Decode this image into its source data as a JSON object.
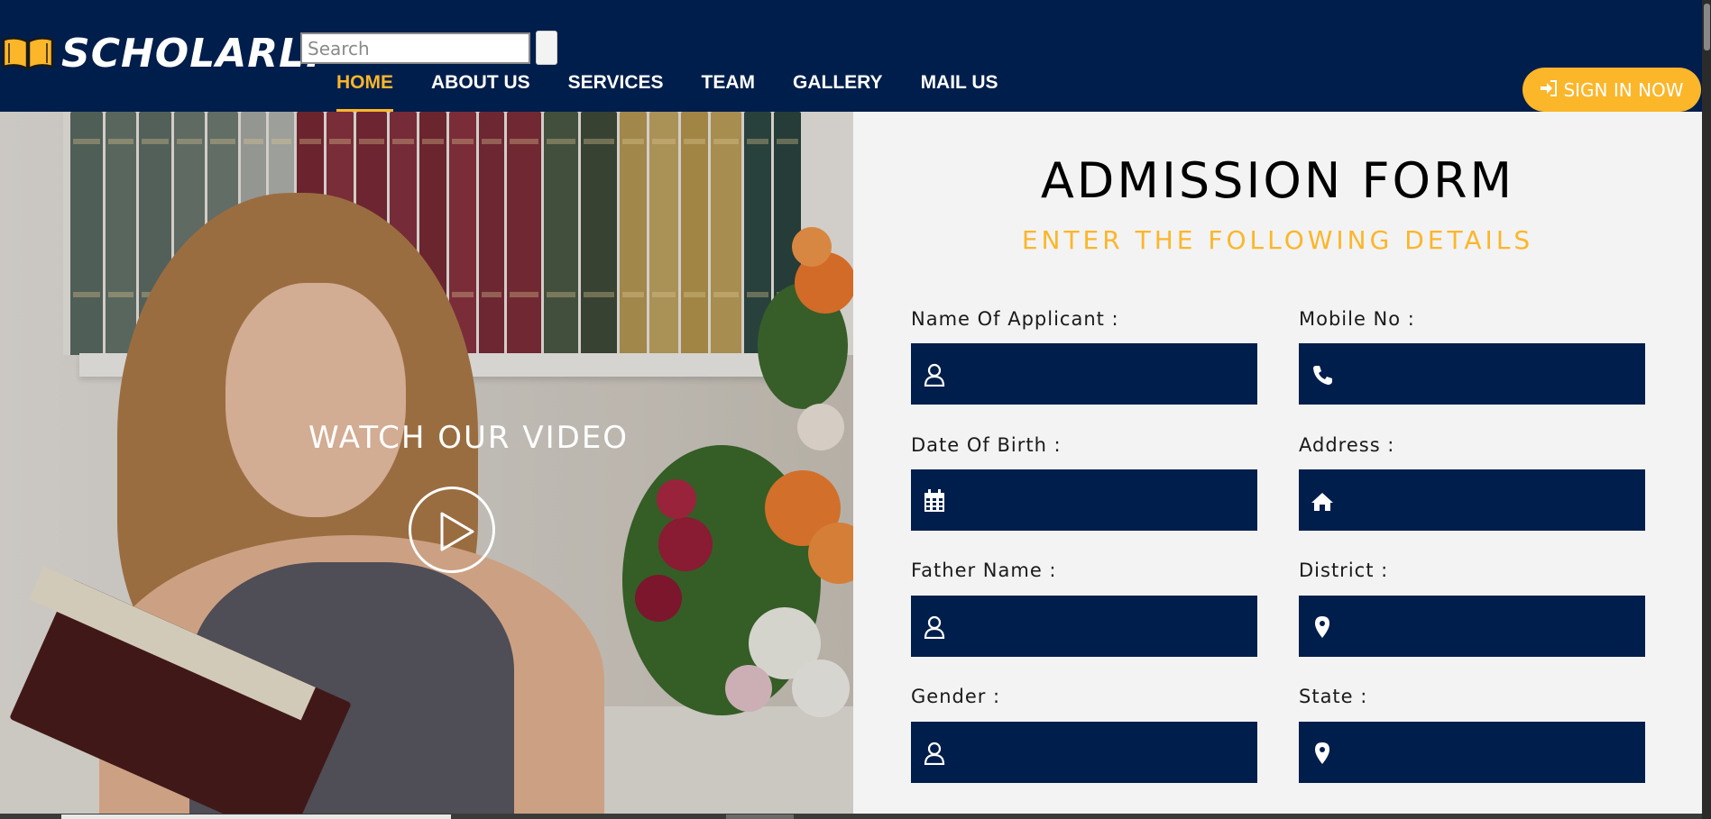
{
  "brand": {
    "name": "SCHOLARLY",
    "logo_icon": "open-book-icon"
  },
  "search": {
    "placeholder": "Search",
    "value": ""
  },
  "nav": {
    "items": [
      {
        "label": "HOME",
        "active": true
      },
      {
        "label": "ABOUT US",
        "active": false
      },
      {
        "label": "SERVICES",
        "active": false
      },
      {
        "label": "TEAM",
        "active": false
      },
      {
        "label": "GALLERY",
        "active": false
      },
      {
        "label": "MAIL US",
        "active": false
      }
    ]
  },
  "signin": {
    "label": "SIGN IN NOW",
    "icon": "sign-in-icon"
  },
  "hero": {
    "video_title": "WATCH OUR VIDEO",
    "play_icon": "play-icon"
  },
  "form": {
    "title": "ADMISSION FORM",
    "subtitle": "ENTER THE FOLLOWING DETAILS",
    "fields": [
      {
        "label": "Name Of Applicant :",
        "icon": "user-icon",
        "value": ""
      },
      {
        "label": "Mobile No :",
        "icon": "phone-icon",
        "value": ""
      },
      {
        "label": "Date Of Birth :",
        "icon": "calendar-icon",
        "value": ""
      },
      {
        "label": "Address :",
        "icon": "home-icon",
        "value": ""
      },
      {
        "label": "Father Name :",
        "icon": "user-icon",
        "value": ""
      },
      {
        "label": "District :",
        "icon": "map-marker-icon",
        "value": ""
      },
      {
        "label": "Gender :",
        "icon": "user-icon",
        "value": ""
      },
      {
        "label": "State :",
        "icon": "map-marker-icon",
        "value": ""
      }
    ]
  },
  "colors": {
    "navy": "#001e4b",
    "accent": "#fbb62a",
    "panel": "#f3f3f3"
  }
}
